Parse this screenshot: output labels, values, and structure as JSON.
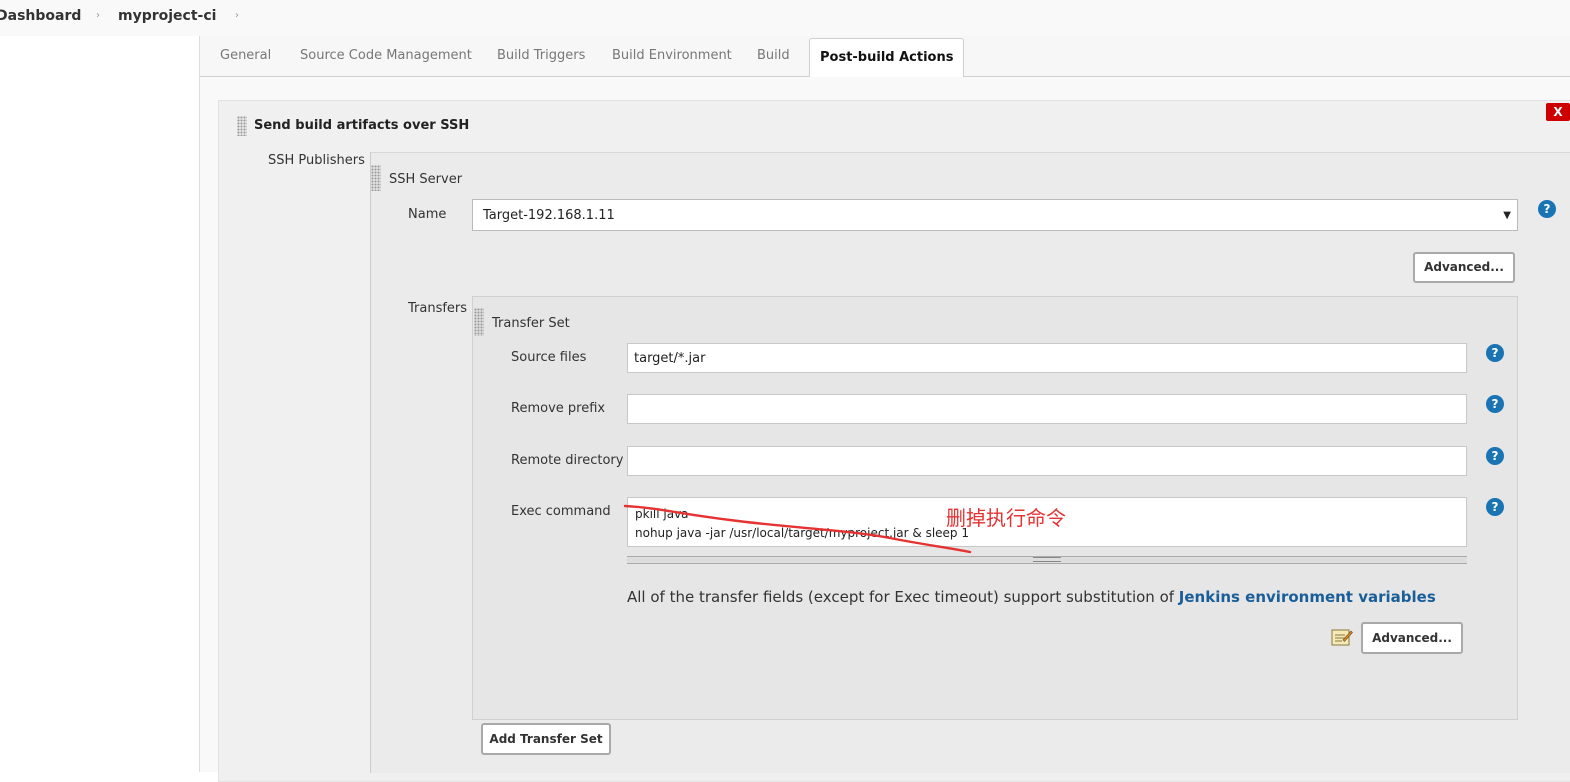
{
  "breadcrumb": {
    "dashboard": "Dashboard",
    "project": "myproject-ci",
    "sep": "›"
  },
  "tabs": [
    {
      "label": "General"
    },
    {
      "label": "Source Code Management"
    },
    {
      "label": "Build Triggers"
    },
    {
      "label": "Build Environment"
    },
    {
      "label": "Build"
    },
    {
      "label": "Post-build Actions",
      "active": true
    }
  ],
  "section": {
    "title": "Send build artifacts over SSH",
    "delete_label": "X"
  },
  "ssh": {
    "publishers_label": "SSH Publishers",
    "server_label": "SSH Server",
    "name_label": "Name",
    "name_value": "Target-192.168.1.11",
    "advanced_label": "Advanced..."
  },
  "transfers": {
    "label": "Transfers",
    "set_label": "Transfer Set",
    "source_files_label": "Source files",
    "source_files_value": "target/*.jar",
    "remove_prefix_label": "Remove prefix",
    "remove_prefix_value": "",
    "remote_directory_label": "Remote directory",
    "remote_directory_value": "",
    "exec_command_label": "Exec command",
    "exec_command_value": "pkill java\nnohup java -jar /usr/local/target/myproject.jar & sleep 1",
    "env_text": "All of the transfer fields (except for Exec timeout) support substitution of ",
    "env_link": "Jenkins environment variables",
    "advanced_label": "Advanced...",
    "add_transfer_set_label": "Add Transfer Set"
  },
  "annotation": {
    "text": "删掉执行命令",
    "color": "#e53333"
  },
  "help_label": "?",
  "colors": {
    "accent": "#1a73b3",
    "link": "#1a5e99",
    "delete": "#cc0000"
  }
}
